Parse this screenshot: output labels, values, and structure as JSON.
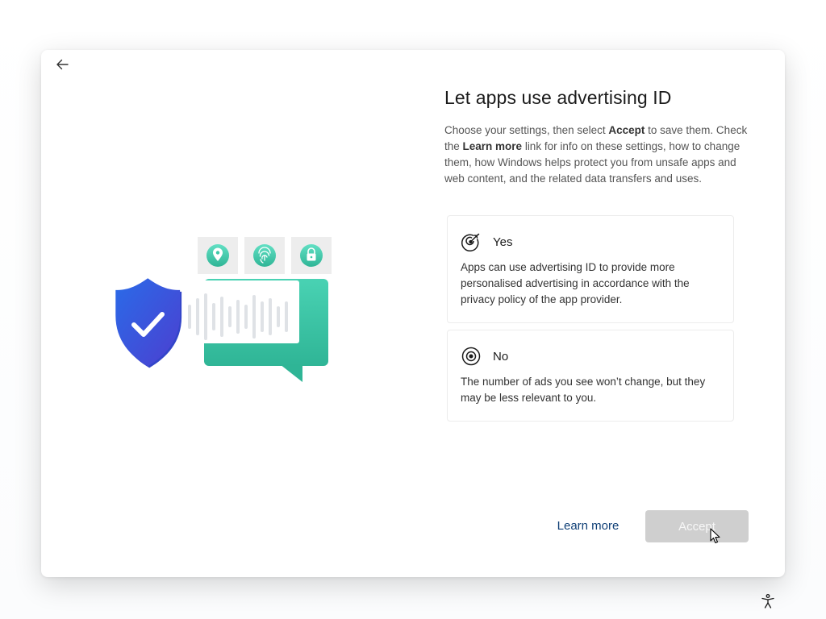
{
  "header": {
    "back_icon": "arrow-left-icon"
  },
  "main": {
    "title": "Let apps use advertising ID",
    "description": {
      "part1": "Choose your settings, then select ",
      "accept_bold": "Accept",
      "part2": " to save them. Check the ",
      "learn_more_bold": "Learn more",
      "part3": " link for info on these settings, how to change them, how Windows helps protect you from unsafe apps and web content, and the related data transfers and uses."
    },
    "options": [
      {
        "label": "Yes",
        "icon": "target-arrow-icon",
        "description": "Apps can use advertising ID to provide more personalised advertising in accordance with the privacy policy of the app provider."
      },
      {
        "label": "No",
        "icon": "target-icon",
        "description": "The number of ads you see won’t change, but they may be less relevant to you."
      }
    ]
  },
  "footer": {
    "learn_more_label": "Learn more",
    "accept_label": "Accept",
    "accept_enabled": false
  },
  "illustration": {
    "icons": [
      "location-pin-icon",
      "fingerprint-icon",
      "padlock-icon",
      "shield-check-icon",
      "chat-bubble-icon",
      "soundwave-icon"
    ]
  },
  "system": {
    "accessibility_icon": "accessibility-icon"
  },
  "colors": {
    "accent_teal": "#3fc9a9",
    "shield_blue": "#2f4fdc",
    "link_blue": "#0f3f76",
    "disabled_button": "#cfcfcf"
  }
}
